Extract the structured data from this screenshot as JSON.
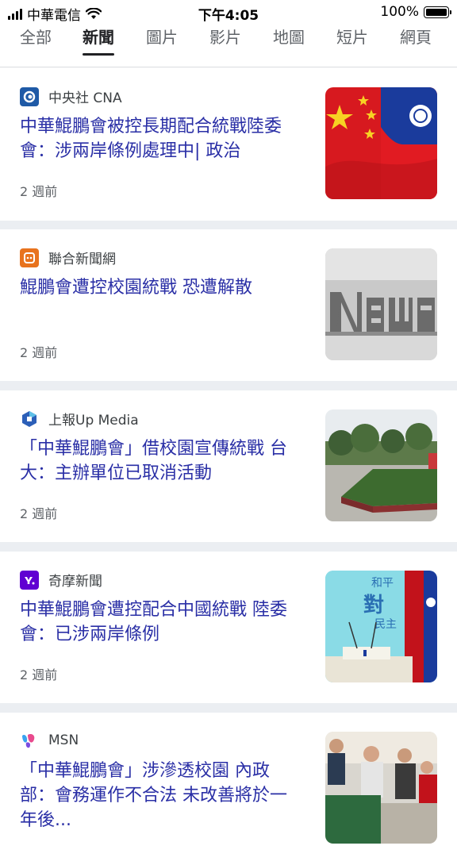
{
  "status_bar": {
    "carrier": "中華電信",
    "time": "下午4:05",
    "battery": "100%"
  },
  "tabs": [
    "全部",
    "新聞",
    "圖片",
    "影片",
    "地圖",
    "短片",
    "網頁"
  ],
  "active_tab": "新聞",
  "articles": [
    {
      "source": "中央社 CNA",
      "logo_icon": "cna-logo-icon",
      "headline": "中華鯤鵬會被控長期配合統戰陸委會：涉兩岸條例處理中| 政治",
      "time": "2 週前",
      "thumb": "flags-image"
    },
    {
      "source": "聯合新聞網",
      "logo_icon": "udn-logo-icon",
      "headline": "鯤鵬會遭控校園統戰 恐遭解散",
      "time": "2 週前",
      "thumb": "news-letters-image"
    },
    {
      "source": "上報Up Media",
      "logo_icon": "upmedia-logo-icon",
      "headline": "「中華鯤鵬會」借校園宣傳統戰 台大：主辦單位已取消活動",
      "time": "2 週前",
      "thumb": "campus-sign-image"
    },
    {
      "source": "奇摩新聞",
      "logo_icon": "yahoo-logo-icon",
      "headline": "中華鯤鵬會遭控配合中國統戰 陸委會：已涉兩岸條例",
      "time": "2 週前",
      "thumb": "press-conference-image",
      "thumb_text": "和平 對等 民主"
    },
    {
      "source": "MSN",
      "logo_icon": "msn-logo-icon",
      "headline": "「中華鯤鵬會」涉滲透校園 內政部：會務運作不合法 未改善將於一年後...",
      "time": "",
      "thumb": "people-meeting-image"
    }
  ],
  "colors": {
    "headline": "#2a2fa6",
    "separator": "#ebeef2",
    "cna": "#1f5aa6",
    "udn": "#e8731e",
    "upmedia": "#2c5fb8",
    "yahoo": "#6001d2"
  }
}
